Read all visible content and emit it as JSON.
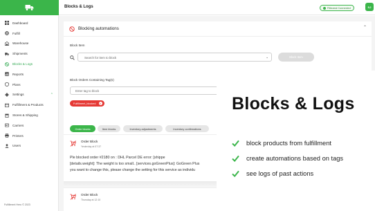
{
  "header": {
    "title": "Blocks & Logs",
    "connection_badge": "Fittezeal Connected",
    "avatar_initials": "SJ"
  },
  "sidebar": {
    "items": [
      {
        "label": "Dashboard",
        "icon": "grid-icon"
      },
      {
        "label": "Fulfill",
        "icon": "globe-icon"
      },
      {
        "label": "Warehouse",
        "icon": "warehouse-icon"
      },
      {
        "label": "Shipments",
        "icon": "truck-icon"
      },
      {
        "label": "Blocks & Logs",
        "icon": "block-icon",
        "active": true
      },
      {
        "label": "Reports",
        "icon": "chart-icon"
      },
      {
        "label": "Plans",
        "icon": "shield-icon"
      },
      {
        "label": "Settings",
        "icon": "gear-icon"
      },
      {
        "label": "Fulfillment & Products",
        "icon": "box-icon"
      },
      {
        "label": "Stores & Shipping",
        "icon": "store-icon"
      },
      {
        "label": "Carriers",
        "icon": "carrier-icon"
      },
      {
        "label": "Printers",
        "icon": "printer-icon"
      },
      {
        "label": "Users",
        "icon": "users-icon"
      }
    ],
    "version": "Fulfillment Hero © 2023"
  },
  "card": {
    "title": "Blocking automations",
    "block_item_label": "Block Item",
    "search_placeholder": "Search for item to block",
    "block_button": "Block Item",
    "tags_label": "Block Orders Containing Tag(s)",
    "tag_placeholder": "Enter tag to block",
    "tag_chip": "Fulfillment_blocked"
  },
  "tabs": [
    "Order blocks",
    "Item blocks",
    "Inventory adjustments",
    "Inventory confirmations"
  ],
  "logs": [
    {
      "name": "Order Block",
      "time": "Yesterday at 07:37",
      "lines": [
        "Ple                 blocked order #2180 on               : DHL Parcel DE error: [shippe",
        "[details.weight]: The weight is too small.. [services.goGreenPlus]: GoGreen Plus",
        "you want to change this, please change the setting for this service as individu"
      ]
    },
    {
      "name": "Order Block",
      "time": "Thursday at 12:10"
    }
  ],
  "promo": {
    "title": "Blocks & Logs",
    "features": [
      "block products from fulfillment",
      "create automations based on tags",
      "see logs of past actions"
    ]
  },
  "colors": {
    "brand_green": "#3bb54a",
    "danger_red": "#e53935"
  }
}
